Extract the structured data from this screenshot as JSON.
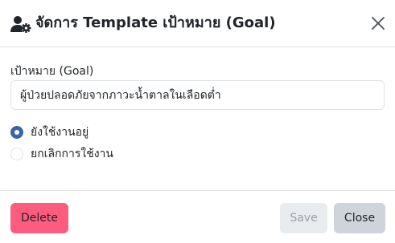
{
  "header": {
    "title": "จัดการ Template เป้าหมาย (Goal)",
    "icon": "user-gear-icon",
    "close_icon": "close-icon"
  },
  "form": {
    "goal_label": "เป้าหมาย (Goal)",
    "goal_value": "ผู้ป่วยปลอดภัยจากภาวะน้ำตาลในเลือดต่ำ",
    "status_options": [
      {
        "label": "ยังใช้งานอยู่",
        "checked": true
      },
      {
        "label": "ยกเลิกการใช้งาน",
        "checked": false
      }
    ]
  },
  "footer": {
    "delete_label": "Delete",
    "save_label": "Save",
    "save_disabled": true,
    "close_label": "Close"
  },
  "colors": {
    "delete": "#fd5c7e",
    "radio_checked": "#3b66a5",
    "save_disabled_bg": "#e9ecef",
    "close_bg": "#ced4da",
    "divider": "#dee2e6"
  }
}
